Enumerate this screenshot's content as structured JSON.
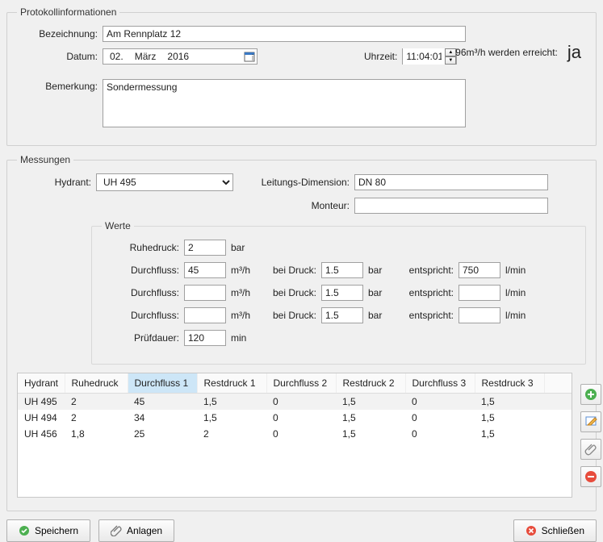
{
  "protokoll": {
    "legend": "Protokollinformationen",
    "bezeichnung_label": "Bezeichnung:",
    "bezeichnung": "Am Rennplatz 12",
    "datum_label": "Datum:",
    "datum_day": "02.",
    "datum_month": "März",
    "datum_year": "2016",
    "uhrzeit_label": "Uhrzeit:",
    "uhrzeit": "11:04:01",
    "bemerkung_label": "Bemerkung:",
    "bemerkung": "Sondermessung",
    "status_text": "96m³/h werden erreicht:",
    "status_value": "ja"
  },
  "messungen": {
    "legend": "Messungen",
    "hydrant_label": "Hydrant:",
    "hydrant": "UH 495",
    "leitungs_label": "Leitungs-Dimension:",
    "leitungs": "DN 80",
    "monteur_label": "Monteur:",
    "monteur": ""
  },
  "werte": {
    "legend": "Werte",
    "ruhedruck_label": "Ruhedruck:",
    "ruhedruck": "2",
    "bar": "bar",
    "durchfluss_label": "Durchfluss:",
    "m3h": "m³/h",
    "bei_druck_label": "bei Druck:",
    "entspricht_label": "entspricht:",
    "lmin": "l/min",
    "rows": [
      {
        "durchfluss": "45",
        "druck": "1.5",
        "entspricht": "750"
      },
      {
        "durchfluss": "",
        "druck": "1.5",
        "entspricht": ""
      },
      {
        "durchfluss": "",
        "druck": "1.5",
        "entspricht": ""
      }
    ],
    "pruefdauer_label": "Prüfdauer:",
    "pruefdauer": "120",
    "min": "min"
  },
  "table": {
    "headers": [
      "Hydrant",
      "Ruhedruck",
      "Durchfluss 1",
      "Restdruck 1",
      "Durchfluss 2",
      "Restdruck 2",
      "Durchfluss 3",
      "Restdruck 3"
    ],
    "rows": [
      [
        "UH 495",
        "2",
        "45",
        "1,5",
        "0",
        "1,5",
        "0",
        "1,5"
      ],
      [
        "UH 494",
        "2",
        "34",
        "1,5",
        "0",
        "1,5",
        "0",
        "1,5"
      ],
      [
        "UH 456",
        "1,8",
        "25",
        "2",
        "0",
        "1,5",
        "0",
        "1,5"
      ]
    ]
  },
  "buttons": {
    "speichern": "Speichern",
    "anlagen": "Anlagen",
    "schliessen": "Schließen"
  }
}
